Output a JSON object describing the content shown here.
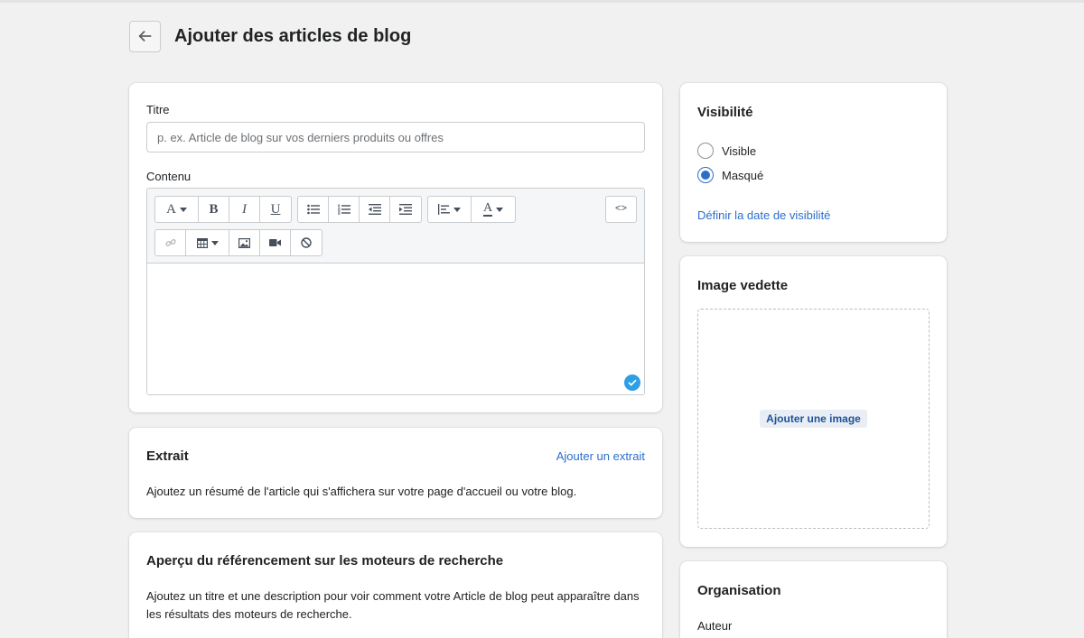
{
  "page": {
    "title": "Ajouter des articles de blog",
    "icons": {
      "back": "arrow-left-icon"
    }
  },
  "main": {
    "title_label": "Titre",
    "title_placeholder": "p. ex. Article de blog sur vos derniers produits ou offres",
    "title_value": "",
    "content_label": "Contenu",
    "toolbar": {
      "row1": [
        "font-style",
        "bold",
        "italic",
        "underline",
        "bullet-list",
        "numbered-list",
        "outdent",
        "indent",
        "align",
        "text-color",
        "show-html"
      ],
      "row2": [
        "link",
        "table",
        "image",
        "video",
        "clear-formatting"
      ],
      "font_glyph": "A",
      "bold_glyph": "B",
      "italic_glyph": "I",
      "underline_glyph": "U",
      "color_glyph": "A",
      "html_glyph": "<>"
    }
  },
  "excerpt": {
    "title": "Extrait",
    "action": "Ajouter un extrait",
    "description": "Ajoutez un résumé de l'article qui s'affichera sur votre page d'accueil ou votre blog."
  },
  "seo": {
    "title": "Aperçu du référencement sur les moteurs de recherche",
    "description": "Ajoutez un titre et une description pour voir comment votre Article de blog peut apparaître dans les résultats des moteurs de recherche."
  },
  "visibility": {
    "title": "Visibilité",
    "options": [
      {
        "label": "Visible",
        "selected": false
      },
      {
        "label": "Masqué",
        "selected": true
      }
    ],
    "set_date_link": "Définir la date de visibilité"
  },
  "featured_image": {
    "title": "Image vedette",
    "add_button": "Ajouter une image"
  },
  "organisation": {
    "title": "Organisation",
    "author_label": "Auteur"
  },
  "colors": {
    "background": "#f1f1f1",
    "card": "#ffffff",
    "link": "#2c6ecb",
    "radio_selected": "#2c6ecb",
    "check_badge": "#2c9fe5"
  }
}
